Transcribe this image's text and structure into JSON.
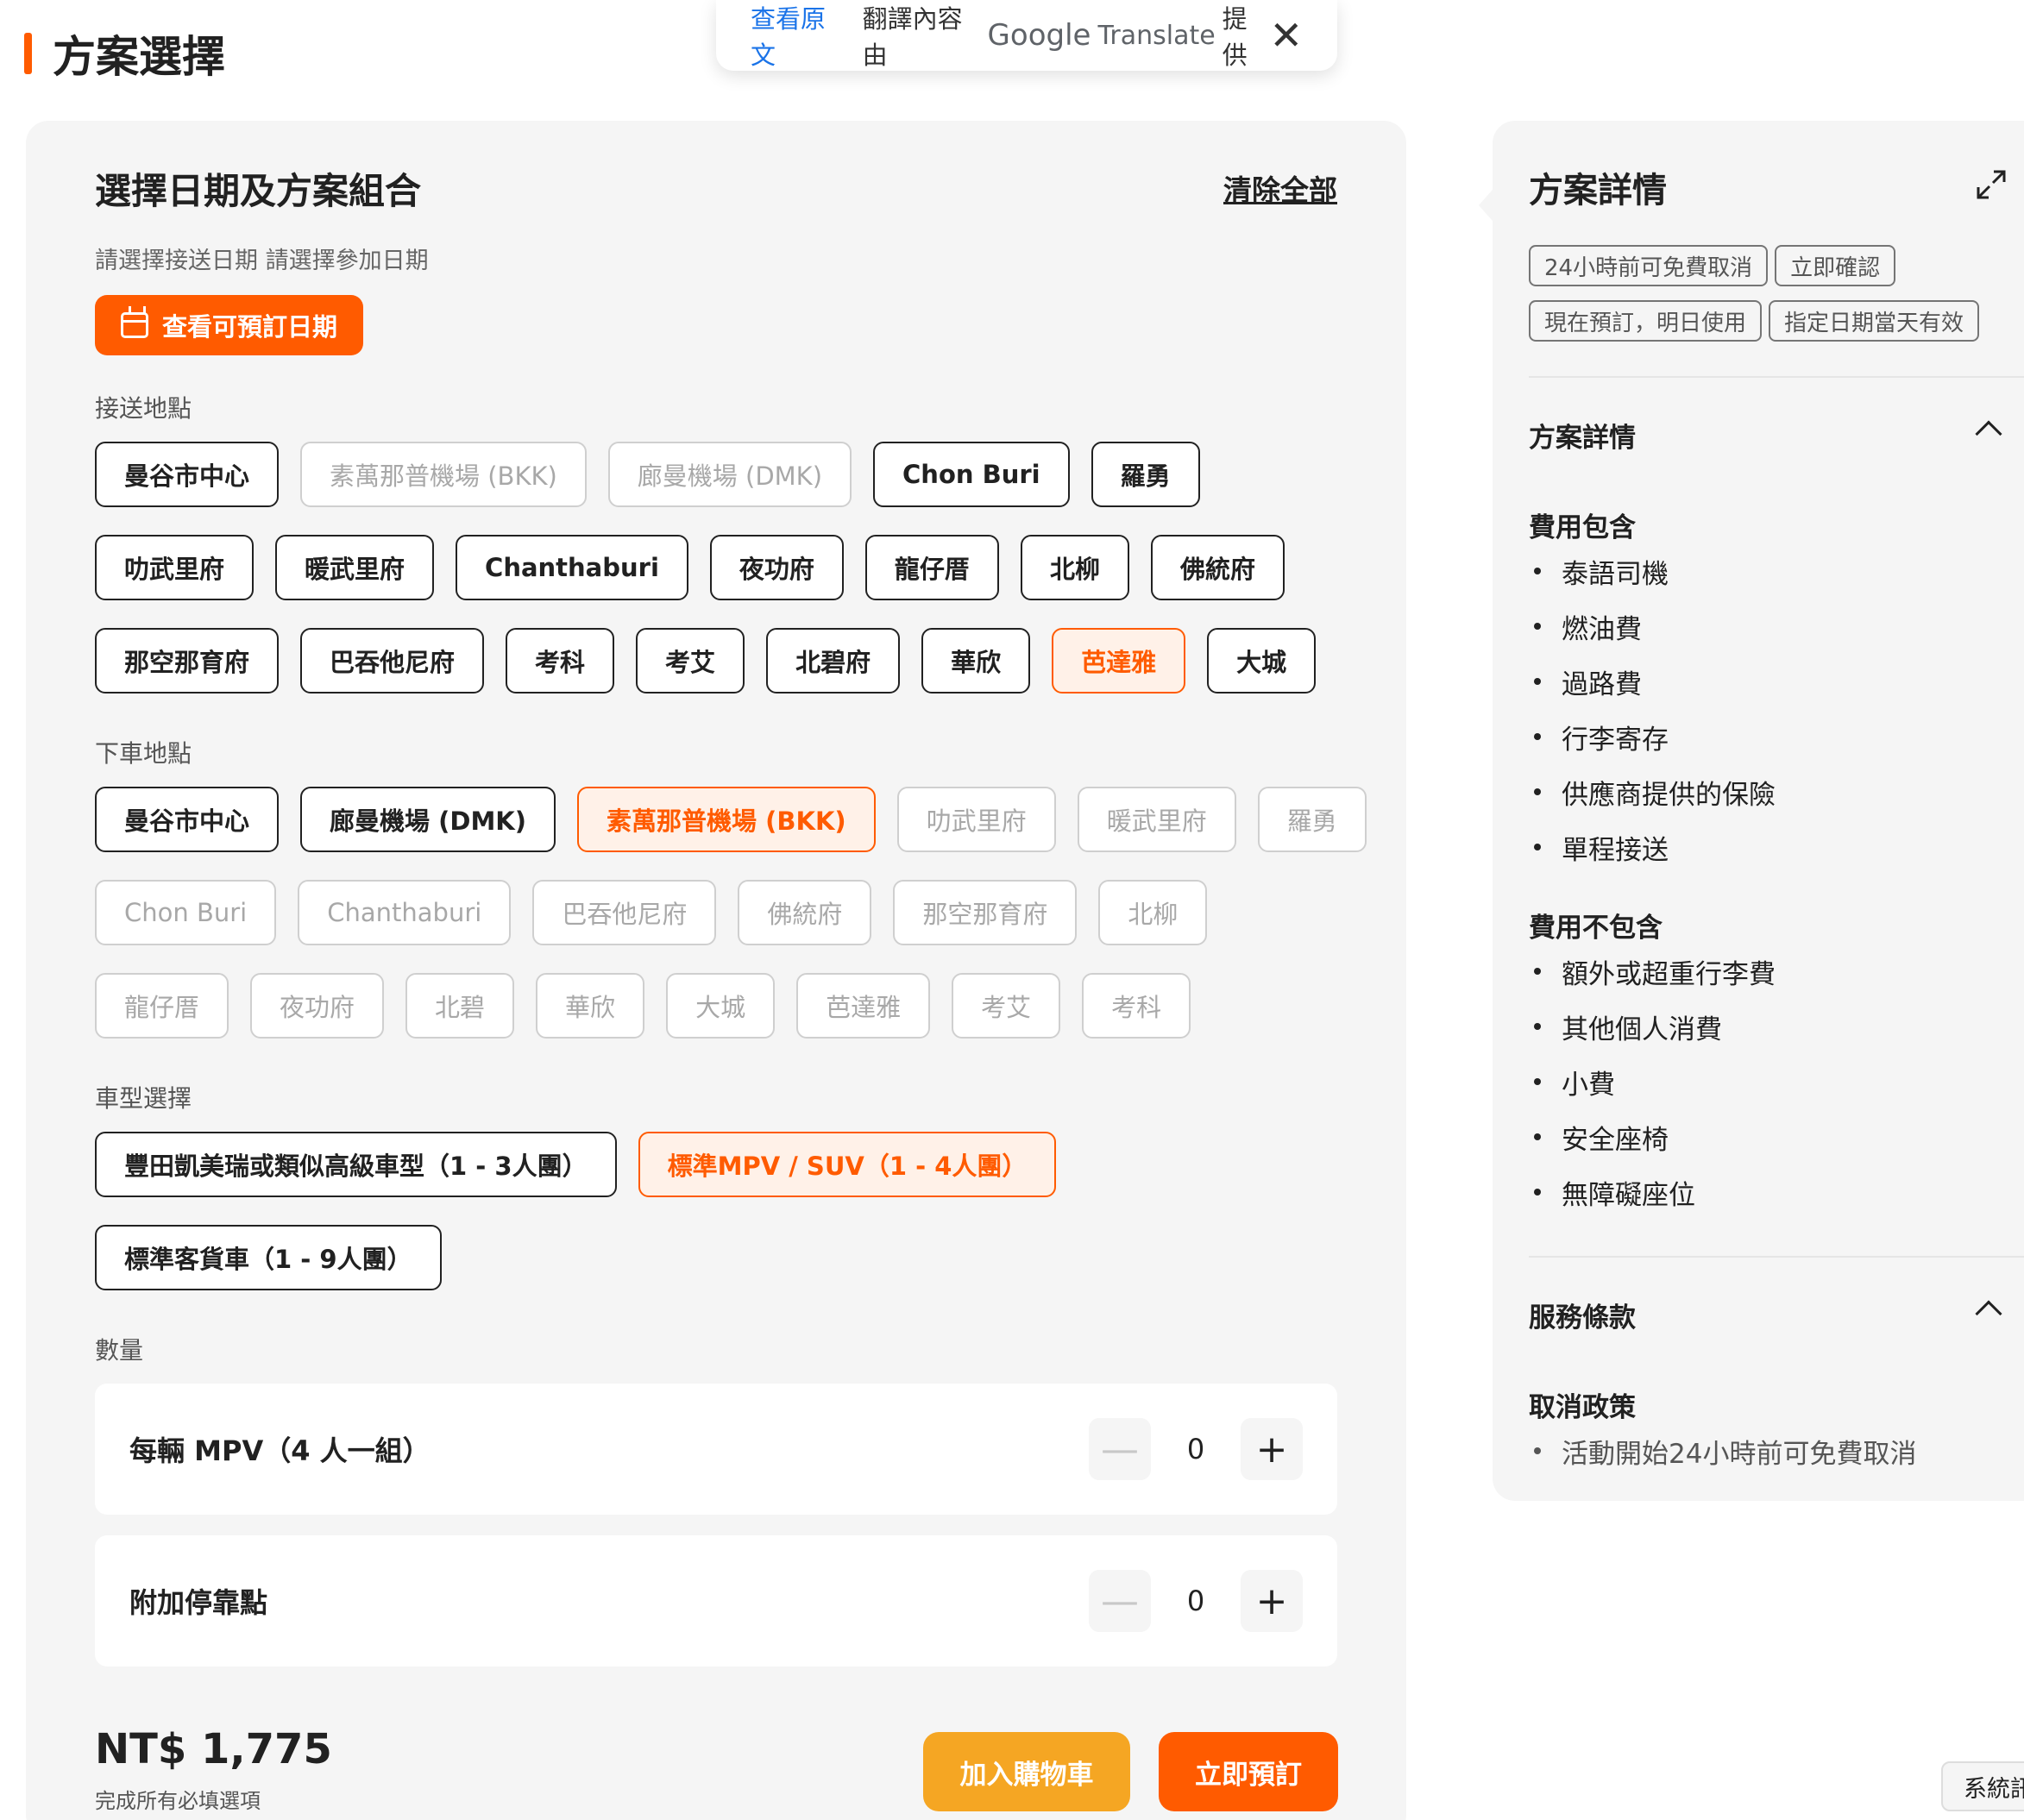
{
  "page": {
    "section_title": "方案選擇",
    "translate": {
      "view_original": "查看原文",
      "translated_by": "翻譯內容由",
      "google": "Google",
      "translate_word": "Translate",
      "provided": "提供",
      "close": "✕"
    }
  },
  "selector": {
    "title": "選擇日期及方案組合",
    "clear_all": "清除全部",
    "hint": "請選擇接送日期 請選擇參加日期",
    "date_button": "查看可預訂日期",
    "pickup": {
      "label": "接送地點",
      "rows": [
        [
          {
            "label": "曼谷市中心",
            "state": "normal"
          },
          {
            "label": "素萬那普機場 (BKK)",
            "state": "disabled"
          },
          {
            "label": "廊曼機場 (DMK)",
            "state": "disabled"
          },
          {
            "label": "Chon Buri",
            "state": "normal"
          },
          {
            "label": "羅勇",
            "state": "normal"
          }
        ],
        [
          {
            "label": "叻武里府",
            "state": "normal"
          },
          {
            "label": "暖武里府",
            "state": "normal"
          },
          {
            "label": "Chanthaburi",
            "state": "normal"
          },
          {
            "label": "夜功府",
            "state": "normal"
          },
          {
            "label": "龍仔厝",
            "state": "normal"
          },
          {
            "label": "北柳",
            "state": "normal"
          },
          {
            "label": "佛統府",
            "state": "normal"
          }
        ],
        [
          {
            "label": "那空那育府",
            "state": "normal"
          },
          {
            "label": "巴吞他尼府",
            "state": "normal"
          },
          {
            "label": "考科",
            "state": "normal"
          },
          {
            "label": "考艾",
            "state": "normal"
          },
          {
            "label": "北碧府",
            "state": "normal"
          },
          {
            "label": "華欣",
            "state": "normal"
          },
          {
            "label": "芭達雅",
            "state": "selected"
          },
          {
            "label": "大城",
            "state": "normal"
          }
        ]
      ]
    },
    "dropoff": {
      "label": "下車地點",
      "rows": [
        [
          {
            "label": "曼谷市中心",
            "state": "normal"
          },
          {
            "label": "廊曼機場 (DMK)",
            "state": "normal"
          },
          {
            "label": "素萬那普機場 (BKK)",
            "state": "selected"
          },
          {
            "label": "叻武里府",
            "state": "disabled"
          },
          {
            "label": "暖武里府",
            "state": "disabled"
          },
          {
            "label": "羅勇",
            "state": "disabled"
          }
        ],
        [
          {
            "label": "Chon Buri",
            "state": "disabled"
          },
          {
            "label": "Chanthaburi",
            "state": "disabled"
          },
          {
            "label": "巴吞他尼府",
            "state": "disabled"
          },
          {
            "label": "佛統府",
            "state": "disabled"
          },
          {
            "label": "那空那育府",
            "state": "disabled"
          },
          {
            "label": "北柳",
            "state": "disabled"
          }
        ],
        [
          {
            "label": "龍仔厝",
            "state": "disabled"
          },
          {
            "label": "夜功府",
            "state": "disabled"
          },
          {
            "label": "北碧",
            "state": "disabled"
          },
          {
            "label": "華欣",
            "state": "disabled"
          },
          {
            "label": "大城",
            "state": "disabled"
          },
          {
            "label": "芭達雅",
            "state": "disabled"
          },
          {
            "label": "考艾",
            "state": "disabled"
          },
          {
            "label": "考科",
            "state": "disabled"
          }
        ]
      ]
    },
    "vehicle": {
      "label": "車型選擇",
      "rows": [
        [
          {
            "label": "豐田凱美瑞或類似高級車型（1 - 3人團）",
            "state": "normal"
          },
          {
            "label": "標準MPV / SUV（1 - 4人團）",
            "state": "selected"
          }
        ],
        [
          {
            "label": "標準客貨車（1 - 9人團）",
            "state": "normal"
          }
        ]
      ]
    },
    "quantity": {
      "label": "數量",
      "items": [
        {
          "label": "每輛 MPV（4 人一組）",
          "value": "0"
        },
        {
          "label": "附加停靠點",
          "value": "0"
        }
      ],
      "minus": "—",
      "plus": "+"
    },
    "price": "NT$ 1,775",
    "price_note": "完成所有必填選項",
    "add_to_cart": "加入購物車",
    "book_now": "立即預訂"
  },
  "details": {
    "title": "方案詳情",
    "tags": [
      "24小時前可免費取消",
      "立即確認",
      "現在預訂，明日使用",
      "指定日期當天有效"
    ],
    "plan_section": "方案詳情",
    "included_title": "費用包含",
    "included": [
      "泰語司機",
      "燃油費",
      "過路費",
      "行李寄存",
      "供應商提供的保險",
      "單程接送"
    ],
    "excluded_title": "費用不包含",
    "excluded": [
      "額外或超重行李費",
      "其他個人消費",
      "小費",
      "安全座椅",
      "無障礙座位"
    ],
    "terms_section": "服務條款",
    "cancel_title": "取消政策",
    "cancel": [
      "活動開始24小時前可免費取消"
    ]
  },
  "system_button": "系統訊息",
  "colors": {
    "accent": "#ff5b00",
    "cart": "#f5a623",
    "panel_bg": "#f5f5f5",
    "link": "#1a73e8"
  }
}
